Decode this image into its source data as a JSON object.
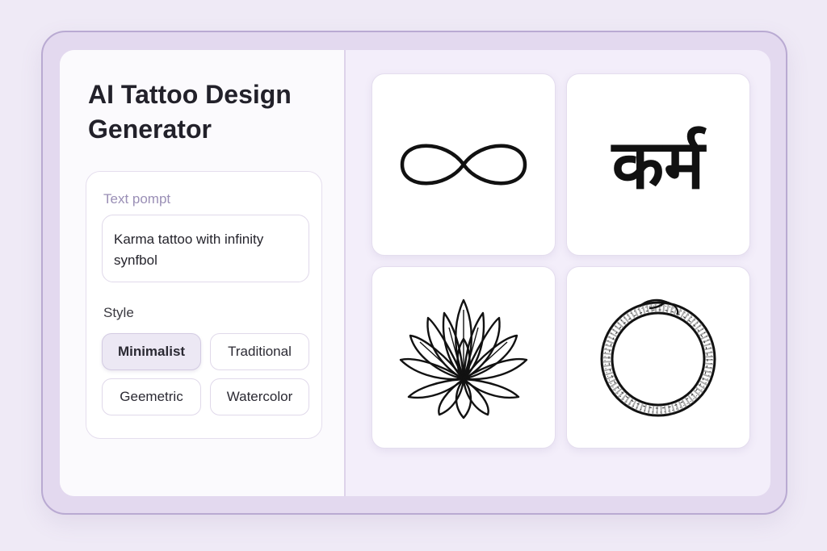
{
  "app": {
    "title": "AI Tattoo Design Generator"
  },
  "prompt": {
    "label": "Text pompt",
    "value": "Karma tattoo with infinity synfbol"
  },
  "style": {
    "label": "Style",
    "options": [
      {
        "label": "Minimalist",
        "selected": true
      },
      {
        "label": "Traditional",
        "selected": false
      },
      {
        "label": "Geemetric",
        "selected": false
      },
      {
        "label": "Watercolor",
        "selected": false
      }
    ]
  },
  "results": [
    {
      "icon": "infinity-icon"
    },
    {
      "icon": "karma-script-icon",
      "text": "कर्म"
    },
    {
      "icon": "lotus-icon"
    },
    {
      "icon": "ouroboros-ring-icon"
    }
  ],
  "colors": {
    "background": "#efeaf6",
    "frame": "#e3d9ef",
    "frame_border": "#b9aad2",
    "selected_chip": "#ece8f4",
    "accent_label": "#9a8fb6"
  }
}
